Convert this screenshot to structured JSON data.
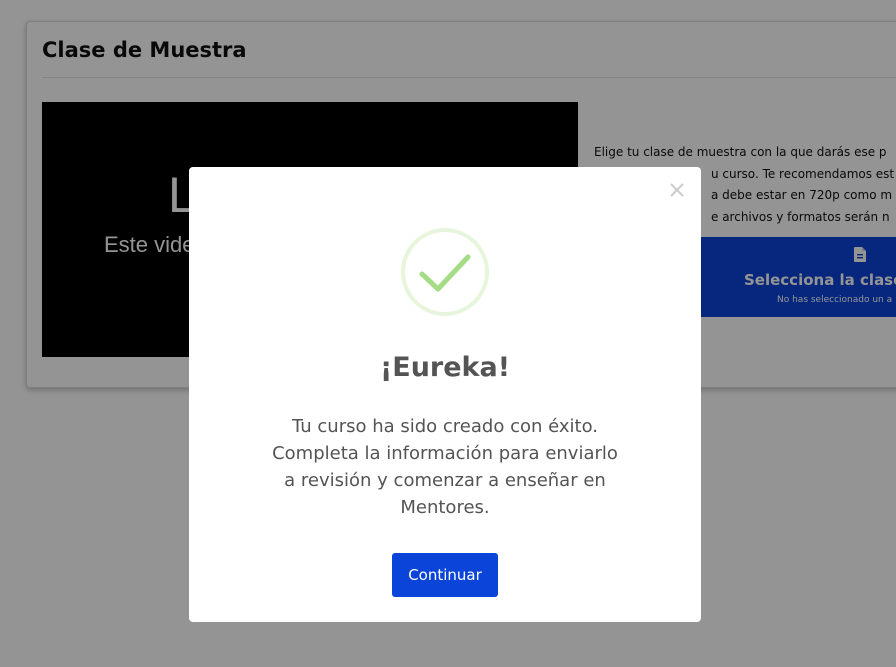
{
  "card": {
    "title": "Clase de Muestra"
  },
  "video": {
    "title": "L",
    "subtitle": "Este vide"
  },
  "instructions": {
    "lines": [
      "Elige tu clase de muestra con la que darás ese p",
      "u curso. Te recomendamos est",
      "a debe estar en 720p como m",
      "e archivos y formatos serán n"
    ]
  },
  "upload": {
    "icon": "file-icon",
    "label": "Selecciona la clase d",
    "sublabel": "No has seleccionado un a"
  },
  "modal": {
    "close_icon": "close-icon",
    "success_icon": "check-circle-icon",
    "title": "¡Eureka!",
    "body_lines": [
      "Tu curso ha sido creado con éxito.",
      "Completa la información para enviarlo",
      "a revisión y comenzar a enseñar en",
      "Mentores."
    ],
    "continue_label": "Continuar"
  },
  "colors": {
    "accent": "#0b44d8",
    "overlay": "rgba(0,0,0,0.42)",
    "success": "#a5dc86",
    "text_muted": "#545454"
  }
}
